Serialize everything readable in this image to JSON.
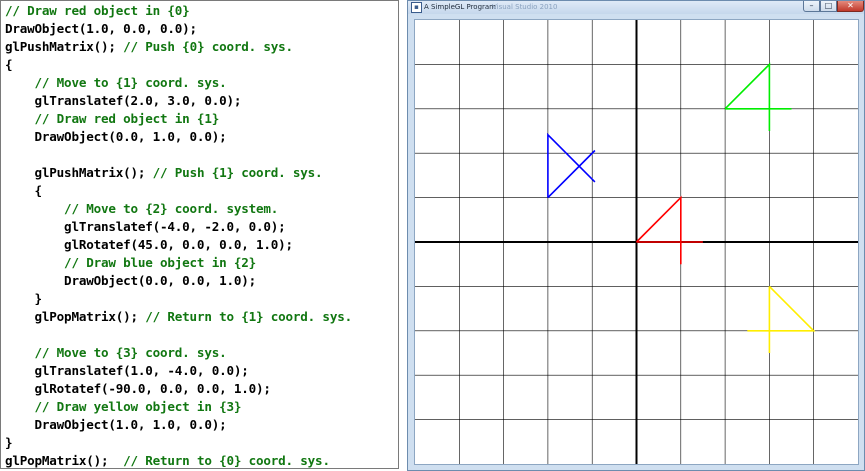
{
  "code_panel": {
    "lines": [
      {
        "text": "// Draw red object in {0}",
        "kind": "comment"
      },
      {
        "text": "DrawObject(1.0, 0.0, 0.0);",
        "kind": "code"
      },
      {
        "text": "glPushMatrix(); ",
        "kind": "code",
        "trail": "// Push {0} coord. sys."
      },
      {
        "text": "{",
        "kind": "code"
      },
      {
        "text": "    // Move to {1} coord. sys.",
        "kind": "comment"
      },
      {
        "text": "    glTranslatef(2.0, 3.0, 0.0);",
        "kind": "code"
      },
      {
        "text": "    // Draw red object in {1}",
        "kind": "comment"
      },
      {
        "text": "    DrawObject(0.0, 1.0, 0.0);",
        "kind": "code"
      },
      {
        "text": "",
        "kind": "code"
      },
      {
        "text": "    glPushMatrix(); ",
        "kind": "code",
        "trail": "// Push {1} coord. sys."
      },
      {
        "text": "    {",
        "kind": "code"
      },
      {
        "text": "        // Move to {2} coord. system.",
        "kind": "comment"
      },
      {
        "text": "        glTranslatef(-4.0, -2.0, 0.0);",
        "kind": "code"
      },
      {
        "text": "        glRotatef(45.0, 0.0, 0.0, 1.0);",
        "kind": "code"
      },
      {
        "text": "        // Draw blue object in {2}",
        "kind": "comment"
      },
      {
        "text": "        DrawObject(0.0, 0.0, 1.0);",
        "kind": "code"
      },
      {
        "text": "    }",
        "kind": "code"
      },
      {
        "text": "    glPopMatrix(); ",
        "kind": "code",
        "trail": "// Return to {1} coord. sys."
      },
      {
        "text": "",
        "kind": "code"
      },
      {
        "text": "    // Move to {3} coord. sys.",
        "kind": "comment"
      },
      {
        "text": "    glTranslatef(1.0, -4.0, 0.0);",
        "kind": "code"
      },
      {
        "text": "    glRotatef(-90.0, 0.0, 0.0, 1.0);",
        "kind": "code"
      },
      {
        "text": "    // Draw yellow object in {3}",
        "kind": "comment"
      },
      {
        "text": "    DrawObject(1.0, 1.0, 0.0);",
        "kind": "code"
      },
      {
        "text": "}",
        "kind": "code"
      },
      {
        "text": "glPopMatrix();  ",
        "kind": "code",
        "trail": "// Return to {0} coord. sys."
      }
    ]
  },
  "app_window": {
    "title": "A SimpleGL Program",
    "subtitle": "Visual Studio 2010",
    "icon_glyph": "▪",
    "buttons": {
      "minimize": "–",
      "maximize": "□",
      "close": "✕"
    }
  },
  "gl_scene": {
    "grid_range": [
      -5,
      5
    ],
    "grid_step": 1,
    "colors": {
      "grid": "#000000",
      "axes": "#000000",
      "red": "#ff0000",
      "green": "#00ee00",
      "blue": "#0000ff",
      "yellow": "#ffee00"
    },
    "objects": [
      {
        "name": "red-object",
        "color": "red",
        "translate": [
          0,
          0
        ],
        "rotate": 0
      },
      {
        "name": "green-object",
        "color": "green",
        "translate": [
          2,
          3
        ],
        "rotate": 0
      },
      {
        "name": "blue-object",
        "color": "blue",
        "translate": [
          -2,
          1
        ],
        "rotate": 45
      },
      {
        "name": "yellow-object",
        "color": "yellow",
        "translate": [
          3,
          -1
        ],
        "rotate": -90
      }
    ]
  }
}
